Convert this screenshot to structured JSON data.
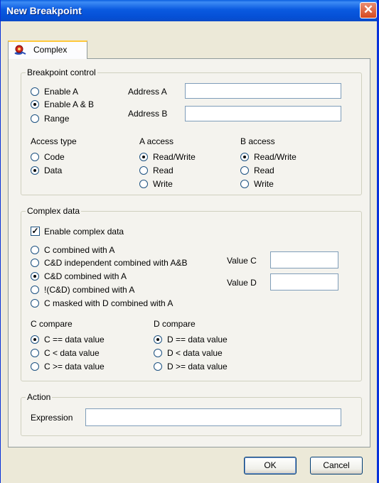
{
  "window": {
    "title": "New Breakpoint",
    "close_glyph": "✕"
  },
  "tab": {
    "label": "Complex",
    "icon": "breakpoint-icon"
  },
  "breakpoint_control": {
    "title": "Breakpoint control",
    "modes": [
      {
        "label": "Enable A",
        "selected": false
      },
      {
        "label": "Enable A & B",
        "selected": true
      },
      {
        "label": "Range",
        "selected": false
      }
    ],
    "address_a": {
      "label": "Address A",
      "value": ""
    },
    "address_b": {
      "label": "Address B",
      "value": ""
    },
    "access_type": {
      "title": "Access type",
      "options": [
        {
          "label": "Code",
          "selected": false
        },
        {
          "label": "Data",
          "selected": true
        }
      ]
    },
    "a_access": {
      "title": "A access",
      "options": [
        {
          "label": "Read/Write",
          "selected": true
        },
        {
          "label": "Read",
          "selected": false
        },
        {
          "label": "Write",
          "selected": false
        }
      ]
    },
    "b_access": {
      "title": "B access",
      "options": [
        {
          "label": "Read/Write",
          "selected": true
        },
        {
          "label": "Read",
          "selected": false
        },
        {
          "label": "Write",
          "selected": false
        }
      ]
    }
  },
  "complex_data": {
    "title": "Complex data",
    "enable": {
      "label": "Enable complex data",
      "checked": true,
      "check_glyph": "✓"
    },
    "combine": [
      {
        "label": "C combined with A",
        "selected": false
      },
      {
        "label": "C&D independent combined with A&B",
        "selected": false
      },
      {
        "label": "C&D combined with A",
        "selected": true
      },
      {
        "label": "!(C&D) combined with A",
        "selected": false
      },
      {
        "label": "C masked with D combined with A",
        "selected": false
      }
    ],
    "value_c": {
      "label": "Value C",
      "value": ""
    },
    "value_d": {
      "label": "Value D",
      "value": ""
    },
    "c_compare": {
      "title": "C compare",
      "options": [
        {
          "label": "C == data value",
          "selected": true
        },
        {
          "label": "C < data value",
          "selected": false
        },
        {
          "label": "C >= data value",
          "selected": false
        }
      ]
    },
    "d_compare": {
      "title": "D compare",
      "options": [
        {
          "label": "D == data value",
          "selected": true
        },
        {
          "label": "D < data value",
          "selected": false
        },
        {
          "label": "D >= data value",
          "selected": false
        }
      ]
    }
  },
  "action": {
    "title": "Action",
    "expression": {
      "label": "Expression",
      "value": ""
    }
  },
  "buttons": {
    "ok": "OK",
    "cancel": "Cancel"
  }
}
